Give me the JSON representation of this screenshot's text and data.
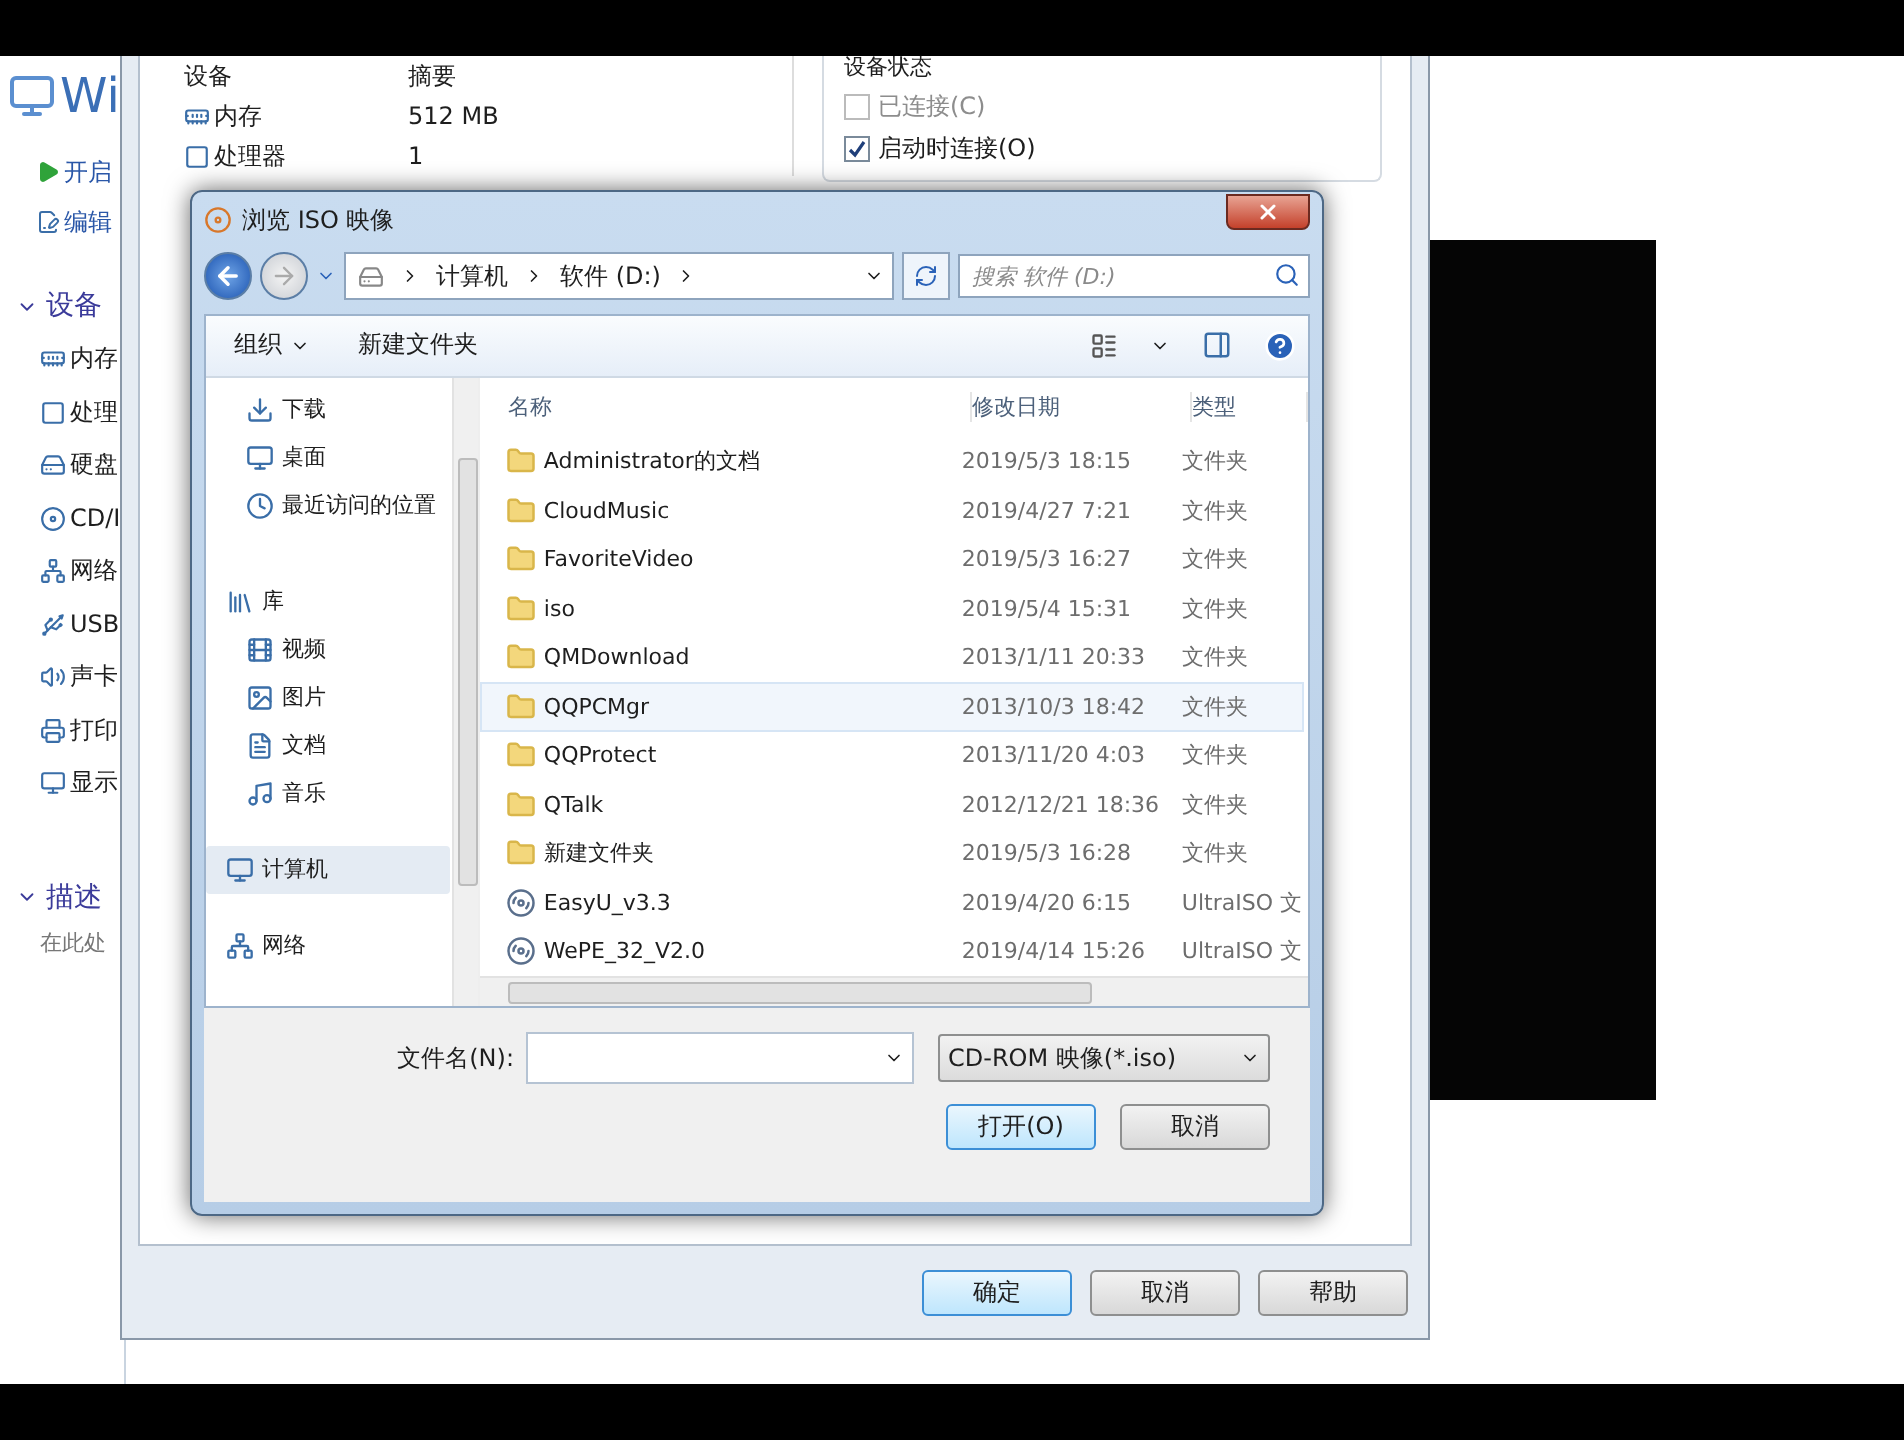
{
  "vm_window": {
    "title": "Wi",
    "actions": [
      {
        "label": "开启",
        "kind": "play"
      },
      {
        "label": "编辑",
        "kind": "edit"
      }
    ],
    "devices_heading": "设备",
    "devices": [
      {
        "label": "内存",
        "kind": "memory"
      },
      {
        "label": "处理",
        "kind": "cpu"
      },
      {
        "label": "硬盘",
        "kind": "disk"
      },
      {
        "label": "CD/I",
        "kind": "cd"
      },
      {
        "label": "网络",
        "kind": "network"
      },
      {
        "label": "USB",
        "kind": "usb"
      },
      {
        "label": "声卡",
        "kind": "sound"
      },
      {
        "label": "打印",
        "kind": "printer"
      },
      {
        "label": "显示",
        "kind": "display"
      }
    ],
    "description_heading": "描述",
    "description_text": "在此处"
  },
  "settings_dialog": {
    "device_table": {
      "columns": [
        "设备",
        "摘要"
      ],
      "rows": [
        {
          "device": "内存",
          "summary": "512 MB",
          "kind": "memory"
        },
        {
          "device": "处理器",
          "summary": "1",
          "kind": "cpu"
        }
      ]
    },
    "device_status": {
      "title": "设备状态",
      "options": [
        {
          "label": "已连接(C)",
          "checked": false,
          "disabled": true
        },
        {
          "label": "启动时连接(O)",
          "checked": true,
          "disabled": false
        }
      ]
    },
    "buttons": [
      {
        "label": "确定",
        "default": true
      },
      {
        "label": "取消",
        "default": false
      },
      {
        "label": "帮助",
        "default": false
      }
    ]
  },
  "file_dialog": {
    "title": "浏览 ISO 映像",
    "breadcrumb": [
      "计算机",
      "软件 (D:)"
    ],
    "search": {
      "placeholder": "搜索 软件 (D:)"
    },
    "toolbar": {
      "organize": "组织",
      "new_folder": "新建文件夹"
    },
    "nav": [
      {
        "label": "下载",
        "kind": "download",
        "selected": false
      },
      {
        "label": "桌面",
        "kind": "desktop",
        "selected": false
      },
      {
        "label": "最近访问的位置",
        "kind": "recent",
        "selected": false
      },
      {
        "label": "库",
        "kind": "library",
        "selected": false,
        "children": [
          {
            "label": "视频",
            "kind": "video",
            "selected": false
          },
          {
            "label": "图片",
            "kind": "picture",
            "selected": false
          },
          {
            "label": "文档",
            "kind": "document",
            "selected": false
          },
          {
            "label": "音乐",
            "kind": "music",
            "selected": false
          }
        ]
      },
      {
        "label": "计算机",
        "kind": "computer",
        "selected": true
      },
      {
        "label": "网络",
        "kind": "network",
        "selected": false
      }
    ],
    "columns": [
      "名称",
      "修改日期",
      "类型"
    ],
    "files": [
      {
        "name": "Administrator的文档",
        "date": "2019/5/3 18:15",
        "type": "文件夹",
        "kind": "folder",
        "selected": false
      },
      {
        "name": "CloudMusic",
        "date": "2019/4/27 7:21",
        "type": "文件夹",
        "kind": "folder",
        "selected": false
      },
      {
        "name": "FavoriteVideo",
        "date": "2019/5/3 16:27",
        "type": "文件夹",
        "kind": "folder",
        "selected": false
      },
      {
        "name": "iso",
        "date": "2019/5/4 15:31",
        "type": "文件夹",
        "kind": "folder",
        "selected": false
      },
      {
        "name": "QMDownload",
        "date": "2013/1/11 20:33",
        "type": "文件夹",
        "kind": "folder",
        "selected": false
      },
      {
        "name": "QQPCMgr",
        "date": "2013/10/3 18:42",
        "type": "文件夹",
        "kind": "folder",
        "selected": true
      },
      {
        "name": "QQProtect",
        "date": "2013/11/20 4:03",
        "type": "文件夹",
        "kind": "folder",
        "selected": false
      },
      {
        "name": "QTalk",
        "date": "2012/12/21 18:36",
        "type": "文件夹",
        "kind": "folder",
        "selected": false
      },
      {
        "name": "新建文件夹",
        "date": "2019/5/3 16:28",
        "type": "文件夹",
        "kind": "folder",
        "selected": false
      },
      {
        "name": "EasyU_v3.3",
        "date": "2019/4/20 6:15",
        "type": "UltraISO 文",
        "kind": "disc-image",
        "selected": false
      },
      {
        "name": "WePE_32_V2.0",
        "date": "2019/4/14 15:26",
        "type": "UltraISO 文",
        "kind": "disc-image",
        "selected": false
      }
    ],
    "filename_label": "文件名(N):",
    "filter": "CD-ROM 映像(*.iso)",
    "buttons": [
      {
        "label": "打开(O)",
        "default": true
      },
      {
        "label": "取消",
        "default": false
      }
    ]
  }
}
